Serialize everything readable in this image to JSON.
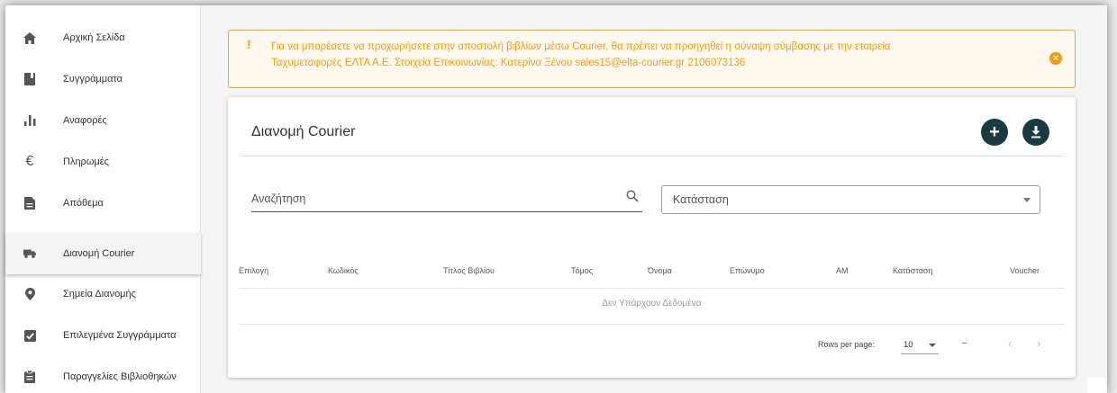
{
  "sidebar": {
    "items": [
      {
        "label": "Αρχική Σελίδα",
        "icon": "home-icon"
      },
      {
        "label": "Συγγράμματα",
        "icon": "book-icon"
      },
      {
        "label": "Αναφορές",
        "icon": "bar-chart-icon"
      },
      {
        "label": "Πληρωμές",
        "icon": "euro-icon"
      },
      {
        "label": "Απόθεμα",
        "icon": "document-icon"
      },
      {
        "label": "Διανομή Courier",
        "icon": "truck-icon",
        "active": true
      },
      {
        "label": "Σημεία Διανομής",
        "icon": "location-pin-icon"
      },
      {
        "label": "Επιλεγμένα Συγγράμματα",
        "icon": "checkbox-icon"
      },
      {
        "label": "Παραγγελίες Βιβλιοθηκών",
        "icon": "clipboard-icon"
      }
    ]
  },
  "alert": {
    "bang": "!",
    "line1": "Για να μπορέσετε να προχωρήσετε στην αποστολή βιβλίων μέσω Courier, θα πρέπει να προηγηθεί η σύναψη σύμβασης με την εταιρεία",
    "line2": "Ταχυμεταφορές ΕΛΤΑ Α.Ε. Στοιχεία Επικοινωνίας: Κατερίνα Ξένου sales15@elta-courier.gr 2106073136",
    "close_glyph": "✕",
    "color": "#f39c12"
  },
  "card": {
    "title": "Διανομή Courier",
    "add_glyph": "+",
    "search_placeholder": "Αναζήτηση",
    "status_placeholder": "Κατάσταση",
    "fab_color": "#1a3a3f"
  },
  "table": {
    "headers": [
      "Επιλογή",
      "Κωδικός",
      "Τίτλος Βιβλίου",
      "Τόμος",
      "Όνομα",
      "Επώνυμο",
      "AM",
      "Κατάσταση",
      "Voucher"
    ],
    "empty_text": "Δεν Υπάρχουν Δεδομένα"
  },
  "pagination": {
    "rows_per_page_label": "Rows per page:",
    "rows_per_page_value": "10",
    "range_text": "–",
    "prev_glyph": "‹",
    "next_glyph": "›"
  }
}
